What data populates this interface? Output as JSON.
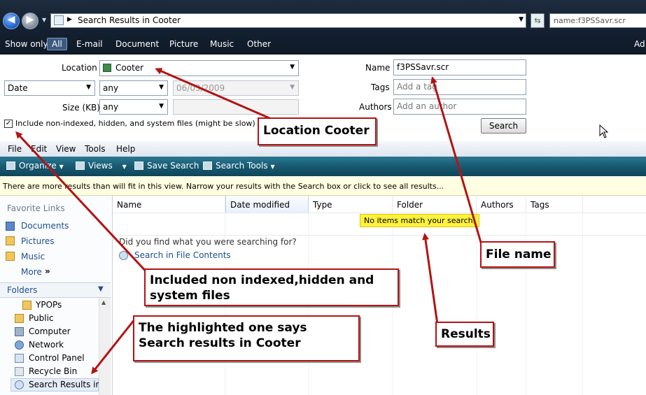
{
  "window": {
    "address": "Search Results in Cooter",
    "search_box_value": "name:f3PSSavr.scr",
    "top_right_fragment": "Ad"
  },
  "show_only": {
    "label": "Show only:",
    "filters": [
      "All",
      "E-mail",
      "Document",
      "Picture",
      "Music",
      "Other"
    ]
  },
  "search_pane": {
    "location_label": "Location",
    "location_value": "Cooter",
    "date_field": "Date",
    "date_qualifier": "any",
    "date_value": "06/03/2009",
    "size_label": "Size (KB)",
    "size_qualifier": "any",
    "include_label": "Include non-indexed, hidden, and system files (might be slow)",
    "include_checked": "✓",
    "name_label": "Name",
    "name_value": "f3PSSavr.scr",
    "tags_label": "Tags",
    "tags_placeholder": "Add a tag",
    "authors_label": "Authors",
    "authors_placeholder": "Add an author",
    "search_button": "Search"
  },
  "menu": [
    "File",
    "Edit",
    "View",
    "Tools",
    "Help"
  ],
  "command_bar": {
    "organize": "Organize",
    "views": "Views",
    "save_search": "Save Search",
    "search_tools": "Search Tools"
  },
  "info_bar": "There are more results than will fit in this view.  Narrow your results with the Search box or click to see all results...",
  "nav": {
    "favorite_links_heading": "Favorite Links",
    "favorite_links": [
      "Documents",
      "Pictures",
      "Music"
    ],
    "more_label": "More",
    "more_arrow": "»",
    "folders_heading": "Folders",
    "tree": [
      "YPOPs",
      "Public",
      "Computer",
      "Network",
      "Control Panel",
      "Recycle Bin",
      "Search Results in C"
    ]
  },
  "columns": [
    "Name",
    "Date modified",
    "Type",
    "Folder",
    "Authors",
    "Tags"
  ],
  "results": {
    "empty_message": "No items match your search.",
    "did_you_find": "Did you find what you were searching for?",
    "search_file_contents": "Search in File Contents"
  },
  "annotations": {
    "location": "Location Cooter",
    "file_name": "File name",
    "included": "Included non indexed,hidden and system files",
    "highlighted": "The highlighted one says Search results in Cooter",
    "results": "Results"
  },
  "colors": {
    "annotation_red": "#b31313",
    "result_highlight": "#fff23d",
    "command_bar": "#175a72",
    "info_bar": "#ffffe1"
  }
}
